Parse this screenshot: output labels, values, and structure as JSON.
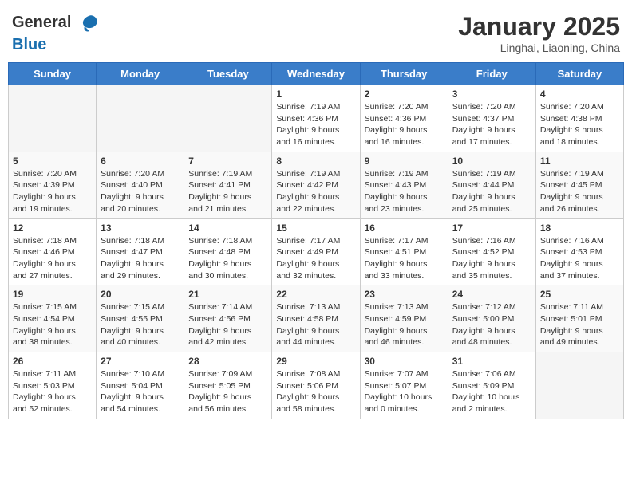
{
  "header": {
    "logo_general": "General",
    "logo_blue": "Blue",
    "title": "January 2025",
    "subtitle": "Linghai, Liaoning, China"
  },
  "weekdays": [
    "Sunday",
    "Monday",
    "Tuesday",
    "Wednesday",
    "Thursday",
    "Friday",
    "Saturday"
  ],
  "weeks": [
    {
      "days": [
        {
          "num": "",
          "info": ""
        },
        {
          "num": "",
          "info": ""
        },
        {
          "num": "",
          "info": ""
        },
        {
          "num": "1",
          "info": "Sunrise: 7:19 AM\nSunset: 4:36 PM\nDaylight: 9 hours and 16 minutes."
        },
        {
          "num": "2",
          "info": "Sunrise: 7:20 AM\nSunset: 4:36 PM\nDaylight: 9 hours and 16 minutes."
        },
        {
          "num": "3",
          "info": "Sunrise: 7:20 AM\nSunset: 4:37 PM\nDaylight: 9 hours and 17 minutes."
        },
        {
          "num": "4",
          "info": "Sunrise: 7:20 AM\nSunset: 4:38 PM\nDaylight: 9 hours and 18 minutes."
        }
      ]
    },
    {
      "days": [
        {
          "num": "5",
          "info": "Sunrise: 7:20 AM\nSunset: 4:39 PM\nDaylight: 9 hours and 19 minutes."
        },
        {
          "num": "6",
          "info": "Sunrise: 7:20 AM\nSunset: 4:40 PM\nDaylight: 9 hours and 20 minutes."
        },
        {
          "num": "7",
          "info": "Sunrise: 7:19 AM\nSunset: 4:41 PM\nDaylight: 9 hours and 21 minutes."
        },
        {
          "num": "8",
          "info": "Sunrise: 7:19 AM\nSunset: 4:42 PM\nDaylight: 9 hours and 22 minutes."
        },
        {
          "num": "9",
          "info": "Sunrise: 7:19 AM\nSunset: 4:43 PM\nDaylight: 9 hours and 23 minutes."
        },
        {
          "num": "10",
          "info": "Sunrise: 7:19 AM\nSunset: 4:44 PM\nDaylight: 9 hours and 25 minutes."
        },
        {
          "num": "11",
          "info": "Sunrise: 7:19 AM\nSunset: 4:45 PM\nDaylight: 9 hours and 26 minutes."
        }
      ]
    },
    {
      "days": [
        {
          "num": "12",
          "info": "Sunrise: 7:18 AM\nSunset: 4:46 PM\nDaylight: 9 hours and 27 minutes."
        },
        {
          "num": "13",
          "info": "Sunrise: 7:18 AM\nSunset: 4:47 PM\nDaylight: 9 hours and 29 minutes."
        },
        {
          "num": "14",
          "info": "Sunrise: 7:18 AM\nSunset: 4:48 PM\nDaylight: 9 hours and 30 minutes."
        },
        {
          "num": "15",
          "info": "Sunrise: 7:17 AM\nSunset: 4:49 PM\nDaylight: 9 hours and 32 minutes."
        },
        {
          "num": "16",
          "info": "Sunrise: 7:17 AM\nSunset: 4:51 PM\nDaylight: 9 hours and 33 minutes."
        },
        {
          "num": "17",
          "info": "Sunrise: 7:16 AM\nSunset: 4:52 PM\nDaylight: 9 hours and 35 minutes."
        },
        {
          "num": "18",
          "info": "Sunrise: 7:16 AM\nSunset: 4:53 PM\nDaylight: 9 hours and 37 minutes."
        }
      ]
    },
    {
      "days": [
        {
          "num": "19",
          "info": "Sunrise: 7:15 AM\nSunset: 4:54 PM\nDaylight: 9 hours and 38 minutes."
        },
        {
          "num": "20",
          "info": "Sunrise: 7:15 AM\nSunset: 4:55 PM\nDaylight: 9 hours and 40 minutes."
        },
        {
          "num": "21",
          "info": "Sunrise: 7:14 AM\nSunset: 4:56 PM\nDaylight: 9 hours and 42 minutes."
        },
        {
          "num": "22",
          "info": "Sunrise: 7:13 AM\nSunset: 4:58 PM\nDaylight: 9 hours and 44 minutes."
        },
        {
          "num": "23",
          "info": "Sunrise: 7:13 AM\nSunset: 4:59 PM\nDaylight: 9 hours and 46 minutes."
        },
        {
          "num": "24",
          "info": "Sunrise: 7:12 AM\nSunset: 5:00 PM\nDaylight: 9 hours and 48 minutes."
        },
        {
          "num": "25",
          "info": "Sunrise: 7:11 AM\nSunset: 5:01 PM\nDaylight: 9 hours and 49 minutes."
        }
      ]
    },
    {
      "days": [
        {
          "num": "26",
          "info": "Sunrise: 7:11 AM\nSunset: 5:03 PM\nDaylight: 9 hours and 52 minutes."
        },
        {
          "num": "27",
          "info": "Sunrise: 7:10 AM\nSunset: 5:04 PM\nDaylight: 9 hours and 54 minutes."
        },
        {
          "num": "28",
          "info": "Sunrise: 7:09 AM\nSunset: 5:05 PM\nDaylight: 9 hours and 56 minutes."
        },
        {
          "num": "29",
          "info": "Sunrise: 7:08 AM\nSunset: 5:06 PM\nDaylight: 9 hours and 58 minutes."
        },
        {
          "num": "30",
          "info": "Sunrise: 7:07 AM\nSunset: 5:07 PM\nDaylight: 10 hours and 0 minutes."
        },
        {
          "num": "31",
          "info": "Sunrise: 7:06 AM\nSunset: 5:09 PM\nDaylight: 10 hours and 2 minutes."
        },
        {
          "num": "",
          "info": ""
        }
      ]
    }
  ]
}
